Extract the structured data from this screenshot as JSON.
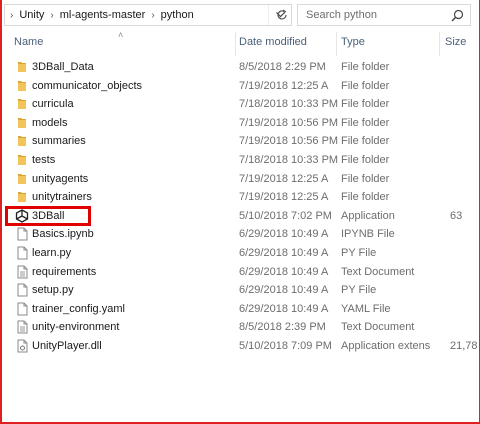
{
  "address": {
    "crumbs": [
      "Unity",
      "ml-agents-master",
      "python"
    ]
  },
  "search": {
    "placeholder": "Search python"
  },
  "columns": {
    "name": "Name",
    "date": "Date modified",
    "type": "Type",
    "size": "Size"
  },
  "files": [
    {
      "name": "3DBall_Data",
      "date": "8/5/2018 2:29 PM",
      "type": "File folder",
      "size": "",
      "icon": "folder-icon"
    },
    {
      "name": "communicator_objects",
      "date": "7/19/2018 12:25 A",
      "type": "File folder",
      "size": "",
      "icon": "folder-icon"
    },
    {
      "name": "curricula",
      "date": "7/18/2018 10:33 PM",
      "type": "File folder",
      "size": "",
      "icon": "folder-icon"
    },
    {
      "name": "models",
      "date": "7/19/2018 10:56 PM",
      "type": "File folder",
      "size": "",
      "icon": "folder-icon"
    },
    {
      "name": "summaries",
      "date": "7/19/2018 10:56 PM",
      "type": "File folder",
      "size": "",
      "icon": "folder-icon"
    },
    {
      "name": "tests",
      "date": "7/18/2018 10:33 PM",
      "type": "File folder",
      "size": "",
      "icon": "folder-icon"
    },
    {
      "name": "unityagents",
      "date": "7/19/2018 12:25 A",
      "type": "File folder",
      "size": "",
      "icon": "folder-icon"
    },
    {
      "name": "unitytrainers",
      "date": "7/19/2018 12:25 A",
      "type": "File folder",
      "size": "",
      "icon": "folder-icon"
    },
    {
      "name": "3DBall",
      "date": "5/10/2018 7:02 PM",
      "type": "Application",
      "size": "63",
      "icon": "unity-app-icon"
    },
    {
      "name": "Basics.ipynb",
      "date": "6/29/2018 10:49 A",
      "type": "IPYNB File",
      "size": "",
      "icon": "file-icon"
    },
    {
      "name": "learn.py",
      "date": "6/29/2018 10:49 A",
      "type": "PY File",
      "size": "",
      "icon": "file-icon"
    },
    {
      "name": "requirements",
      "date": "6/29/2018 10:49 A",
      "type": "Text Document",
      "size": "",
      "icon": "text-file-icon"
    },
    {
      "name": "setup.py",
      "date": "6/29/2018 10:49 A",
      "type": "PY File",
      "size": "",
      "icon": "file-icon"
    },
    {
      "name": "trainer_config.yaml",
      "date": "6/29/2018 10:49 A",
      "type": "YAML File",
      "size": "",
      "icon": "file-icon"
    },
    {
      "name": "unity-environment",
      "date": "8/5/2018 2:39 PM",
      "type": "Text Document",
      "size": "",
      "icon": "text-file-icon"
    },
    {
      "name": "UnityPlayer.dll",
      "date": "5/10/2018 7:09 PM",
      "type": "Application extens",
      "size": "21,78",
      "icon": "dll-file-icon"
    }
  ],
  "colors": {
    "folder": "#e8b84a",
    "highlight": "#e00000",
    "header_text": "#4c607a"
  }
}
